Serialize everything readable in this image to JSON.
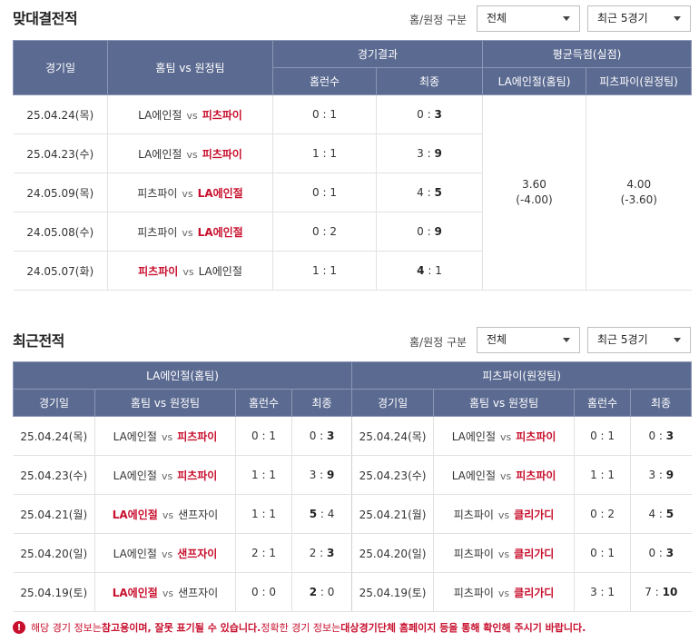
{
  "h2h": {
    "title": "맞대결전적",
    "filter_label": "홈/원정 구분",
    "select_scope": "전체",
    "select_range": "최근 5경기",
    "headers": {
      "date": "경기일",
      "matchup": "홈팀 vs 원정팀",
      "result_group": "경기결과",
      "homeruns": "홈런수",
      "final": "최종",
      "avg_group": "평균득점(실점)",
      "avg_home": "LA에인절(홈팀)",
      "avg_away": "피츠파이(원정팀)"
    },
    "rows": [
      {
        "date": "25.04.24(목)",
        "home": "LA에인절",
        "away": "피츠파이",
        "winner": "away",
        "hr": "0 : 1",
        "final": "0 : 3"
      },
      {
        "date": "25.04.23(수)",
        "home": "LA에인절",
        "away": "피츠파이",
        "winner": "away",
        "hr": "1 : 1",
        "final": "3 : 9"
      },
      {
        "date": "24.05.09(목)",
        "home": "피츠파이",
        "away": "LA에인절",
        "winner": "away",
        "hr": "0 : 1",
        "final": "4 : 5"
      },
      {
        "date": "24.05.08(수)",
        "home": "피츠파이",
        "away": "LA에인절",
        "winner": "away",
        "hr": "0 : 2",
        "final": "0 : 9"
      },
      {
        "date": "24.05.07(화)",
        "home": "피츠파이",
        "away": "LA에인절",
        "winner": "home",
        "hr": "1 : 1",
        "final": "4 : 1"
      }
    ],
    "avg_home_value": "3.60",
    "avg_home_sub": "(-4.00)",
    "avg_away_value": "4.00",
    "avg_away_sub": "(-3.60)"
  },
  "recent": {
    "title": "최근전적",
    "filter_label": "홈/원정 구분",
    "select_scope": "전체",
    "select_range": "최근 5경기",
    "left_team_header": "LA에인절(홈팀)",
    "right_team_header": "피츠파이(원정팀)",
    "headers": {
      "date": "경기일",
      "matchup": "홈팀 vs 원정팀",
      "homeruns": "홈런수",
      "final": "최종"
    },
    "left_rows": [
      {
        "date": "25.04.24(목)",
        "home": "LA에인절",
        "away": "피츠파이",
        "winner": "away",
        "hr": "0 : 1",
        "final": "0 : 3"
      },
      {
        "date": "25.04.23(수)",
        "home": "LA에인절",
        "away": "피츠파이",
        "winner": "away",
        "hr": "1 : 1",
        "final": "3 : 9"
      },
      {
        "date": "25.04.21(월)",
        "home": "LA에인절",
        "away": "샌프자이",
        "winner": "home",
        "hr": "1 : 1",
        "final": "5 : 4"
      },
      {
        "date": "25.04.20(일)",
        "home": "LA에인절",
        "away": "샌프자이",
        "winner": "away",
        "hr": "2 : 1",
        "final": "2 : 3"
      },
      {
        "date": "25.04.19(토)",
        "home": "LA에인절",
        "away": "샌프자이",
        "winner": "home",
        "hr": "0 : 0",
        "final": "2 : 0"
      }
    ],
    "right_rows": [
      {
        "date": "25.04.24(목)",
        "home": "LA에인절",
        "away": "피츠파이",
        "winner": "away",
        "hr": "0 : 1",
        "final": "0 : 3"
      },
      {
        "date": "25.04.23(수)",
        "home": "LA에인절",
        "away": "피츠파이",
        "winner": "away",
        "hr": "1 : 1",
        "final": "3 : 9"
      },
      {
        "date": "25.04.21(월)",
        "home": "피츠파이",
        "away": "클리가디",
        "winner": "away",
        "hr": "0 : 2",
        "final": "4 : 5"
      },
      {
        "date": "25.04.20(일)",
        "home": "피츠파이",
        "away": "클리가디",
        "winner": "away",
        "hr": "0 : 1",
        "final": "0 : 3"
      },
      {
        "date": "25.04.19(토)",
        "home": "피츠파이",
        "away": "클리가디",
        "winner": "away",
        "hr": "3 : 1",
        "final": "7 : 10"
      }
    ]
  },
  "notice": {
    "icon": "exclamation-icon",
    "part1": "해당 경기 정보는 ",
    "part2": "참고용이며, 잘못 표기될 수 있습니다.",
    "part3": " 정확한 경기 정보는 ",
    "part4": "대상경기단체 홈페이지 등을 통해 확인해 주시기 바랍니다."
  },
  "colors": {
    "header_bg": "#5b6a91",
    "winner_red": "#c8102e"
  }
}
